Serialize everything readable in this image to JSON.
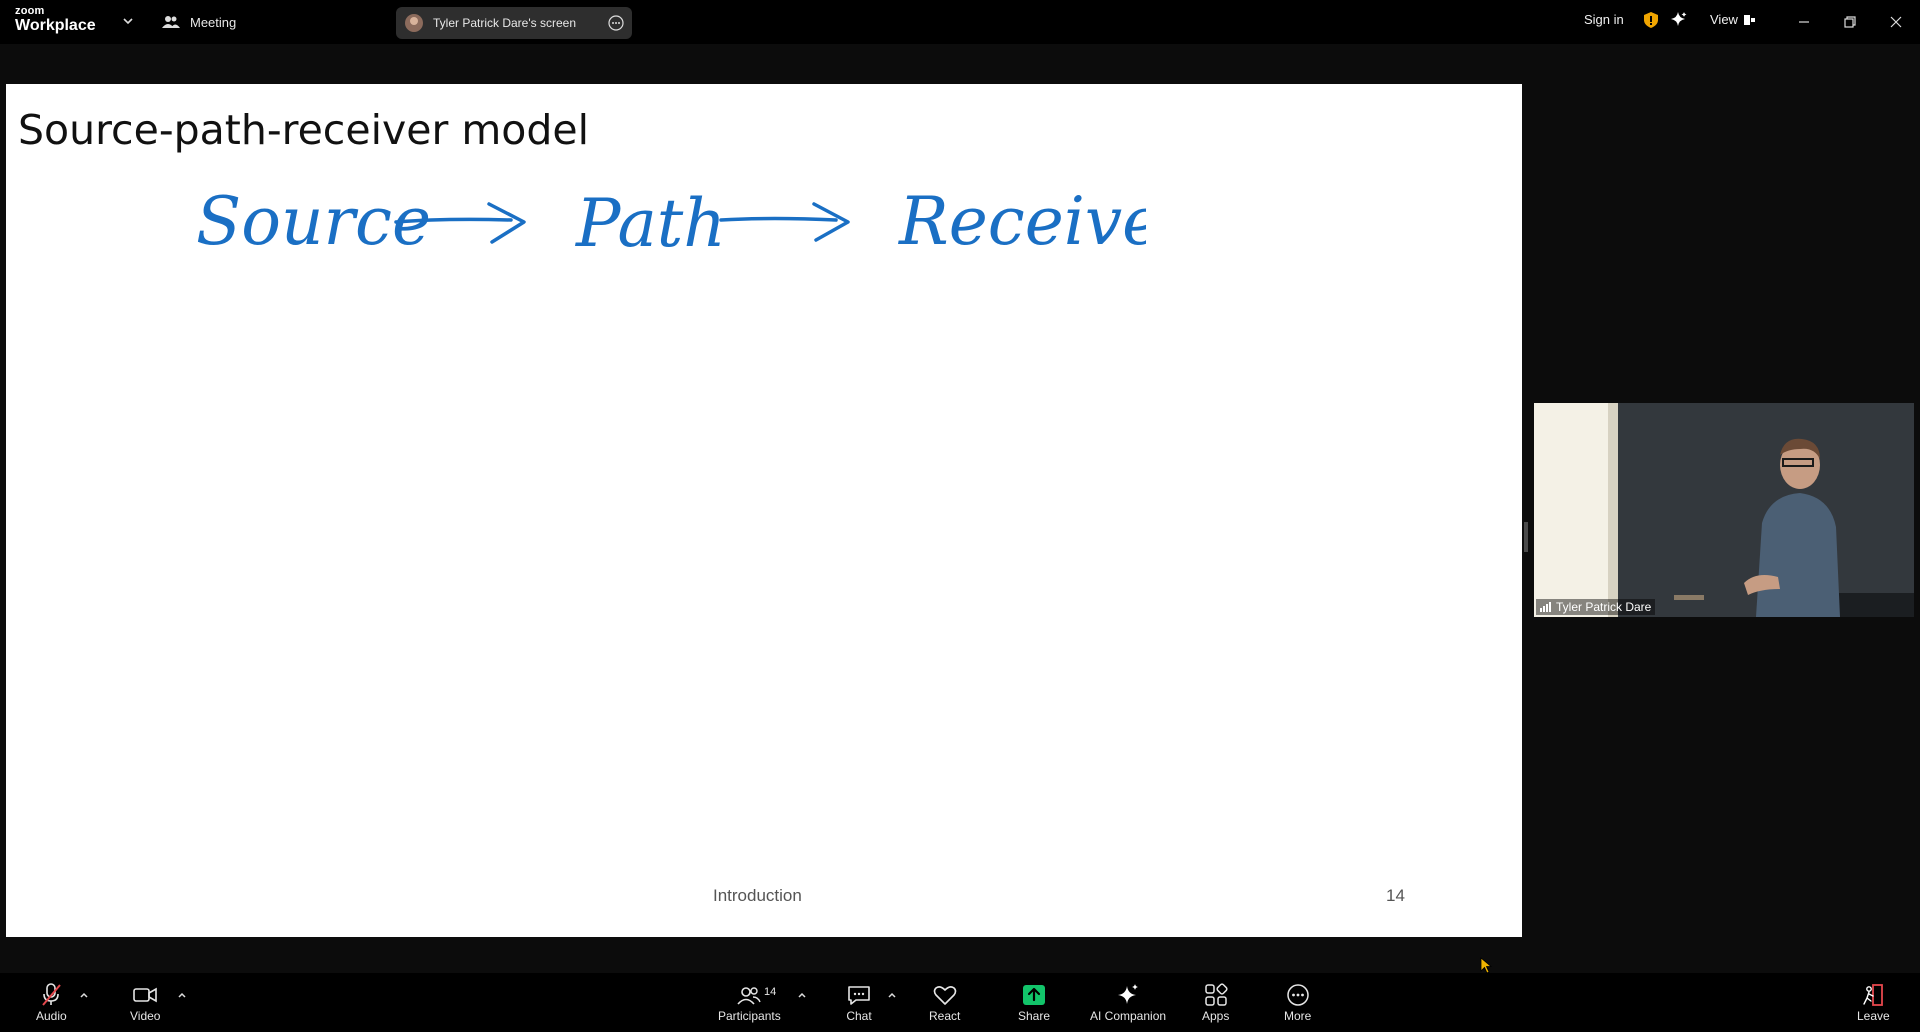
{
  "app": {
    "logo_small": "zoom",
    "logo_big": "Workplace",
    "meeting_label": "Meeting",
    "screen_share_label": "Tyler Patrick Dare's screen",
    "sign_in": "Sign in",
    "view_label": "View"
  },
  "slide": {
    "title": "Source-path-receiver model",
    "handwriting": [
      "Source",
      "Path",
      "Receiver"
    ],
    "footer_section": "Introduction",
    "page_number": "14",
    "ink_color": "#1a6fc4"
  },
  "video": {
    "participant_name": "Tyler Patrick Dare"
  },
  "toolbar": {
    "audio": "Audio",
    "video": "Video",
    "participants": "Participants",
    "participants_count": "14",
    "chat": "Chat",
    "react": "React",
    "share": "Share",
    "ai_companion": "AI Companion",
    "apps": "Apps",
    "more": "More",
    "leave": "Leave",
    "share_color": "#12c46a",
    "leave_color": "#e5484d",
    "muted_color": "#e5484d"
  }
}
